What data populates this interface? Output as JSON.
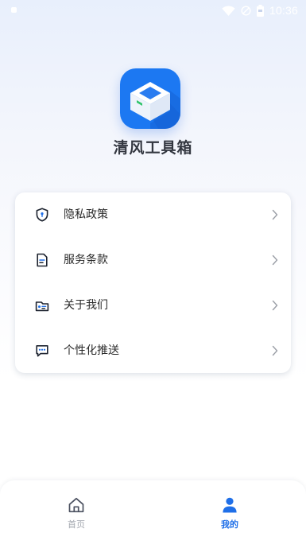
{
  "status_bar": {
    "time": "10:36",
    "icons": [
      "wifi-icon",
      "signal-icon",
      "battery-icon"
    ]
  },
  "app": {
    "name": "清风工具箱",
    "logo_icon": "cube-icon",
    "logo_color": "#1c78f2"
  },
  "menu": {
    "items": [
      {
        "label": "隐私政策",
        "icon": "shield-icon"
      },
      {
        "label": "服务条款",
        "icon": "document-icon"
      },
      {
        "label": "关于我们",
        "icon": "id-card-icon"
      },
      {
        "label": "个性化推送",
        "icon": "message-icon"
      }
    ]
  },
  "bottom_nav": {
    "tabs": [
      {
        "label": "首页",
        "icon": "home-icon",
        "active": false
      },
      {
        "label": "我的",
        "icon": "user-icon",
        "active": true
      }
    ],
    "active_color": "#1f6fe8",
    "inactive_color": "#a4a8b0"
  }
}
